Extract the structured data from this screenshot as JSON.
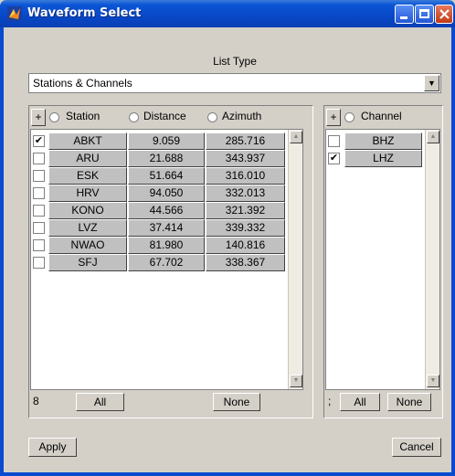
{
  "window": {
    "title": "Waveform Select"
  },
  "list_type": {
    "label": "List Type",
    "selected": "Stations & Channels"
  },
  "stations": {
    "plus_label": "+",
    "columns": [
      "Station",
      "Distance",
      "Azimuth"
    ],
    "rows": [
      {
        "checked": true,
        "station": "ABKT",
        "distance": "9.059",
        "azimuth": "285.716"
      },
      {
        "checked": false,
        "station": "ARU",
        "distance": "21.688",
        "azimuth": "343.937"
      },
      {
        "checked": false,
        "station": "ESK",
        "distance": "51.664",
        "azimuth": "316.010"
      },
      {
        "checked": false,
        "station": "HRV",
        "distance": "94.050",
        "azimuth": "332.013"
      },
      {
        "checked": false,
        "station": "KONO",
        "distance": "44.566",
        "azimuth": "321.392"
      },
      {
        "checked": false,
        "station": "LVZ",
        "distance": "37.414",
        "azimuth": "339.332"
      },
      {
        "checked": false,
        "station": "NWAO",
        "distance": "81.980",
        "azimuth": "140.816"
      },
      {
        "checked": false,
        "station": "SFJ",
        "distance": "67.702",
        "azimuth": "338.367"
      }
    ],
    "count": "8",
    "all_label": "All",
    "none_label": "None"
  },
  "channels": {
    "plus_label": "+",
    "column": "Channel",
    "rows": [
      {
        "checked": false,
        "channel": "BHZ"
      },
      {
        "checked": true,
        "channel": "LHZ"
      }
    ],
    "count": ";",
    "all_label": "All",
    "none_label": "None"
  },
  "actions": {
    "apply_label": "Apply",
    "cancel_label": "Cancel"
  }
}
